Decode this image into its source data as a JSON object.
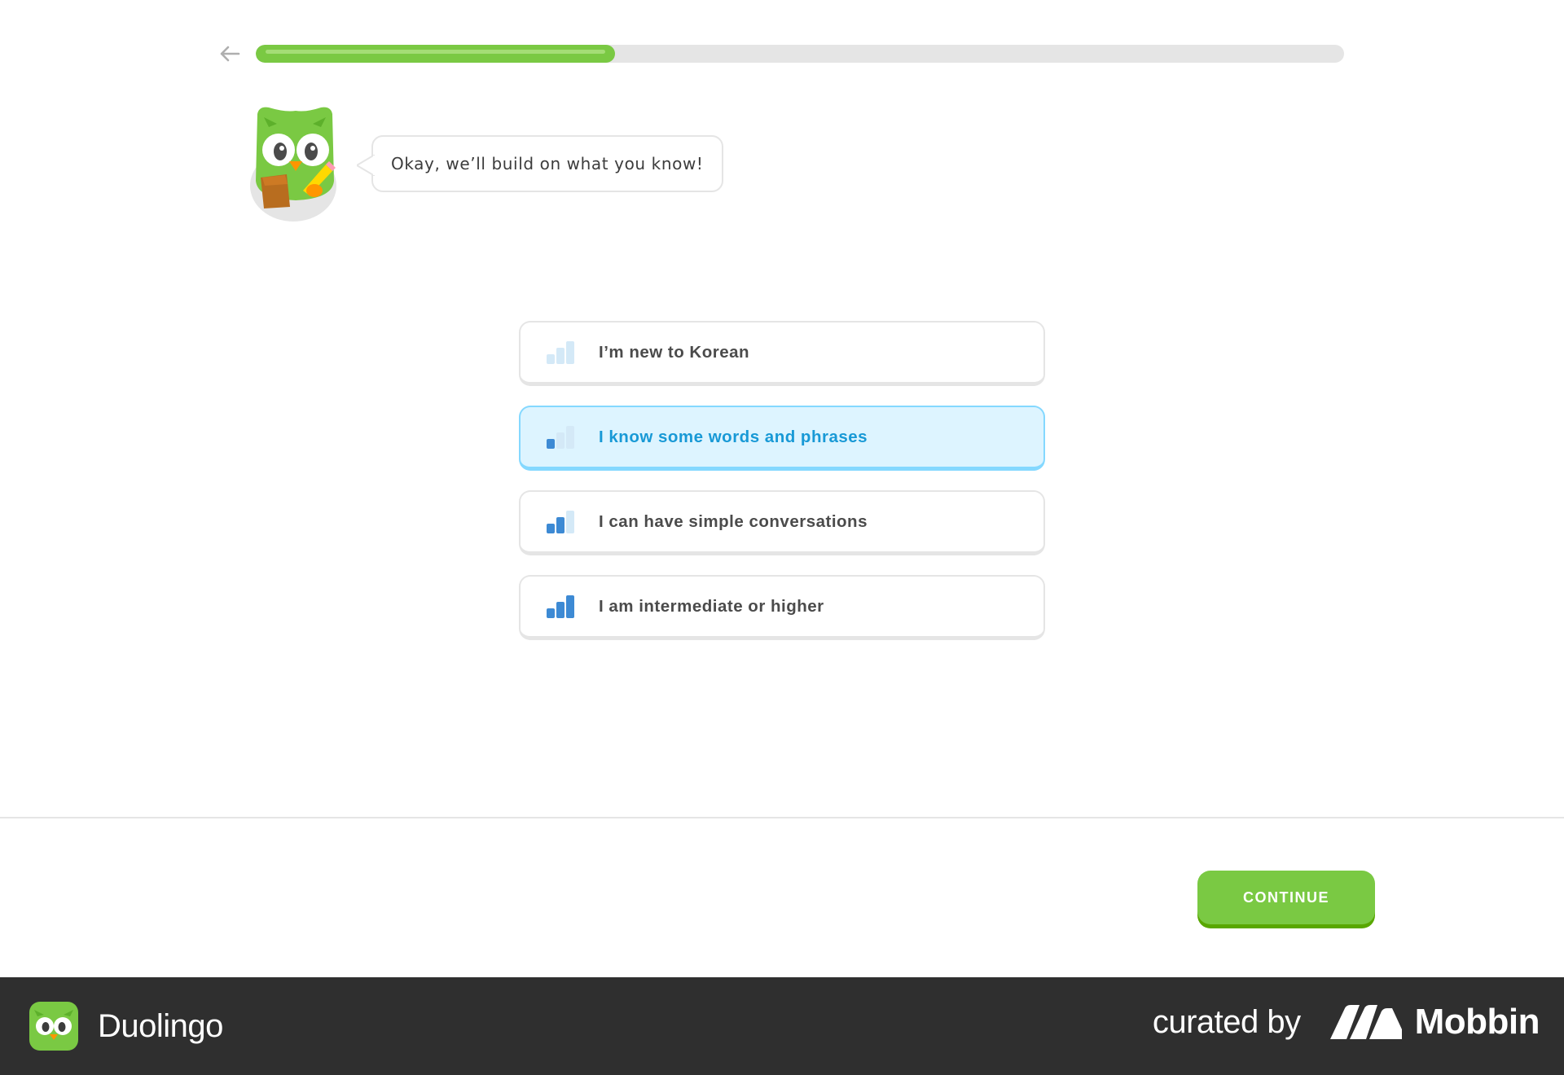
{
  "header": {
    "back_icon": "arrow-left-icon",
    "progress_fraction": 0.33
  },
  "mascot": {
    "icon": "duo-owl-mascot",
    "speech": "Okay, we’ll build on what you know!"
  },
  "options": [
    {
      "label": "I’m new to Korean",
      "level": 0,
      "selected": false,
      "icon": "signal-bars-0-icon"
    },
    {
      "label": "I know some words and phrases",
      "level": 1,
      "selected": true,
      "icon": "signal-bars-1-icon"
    },
    {
      "label": "I can have simple conversations",
      "level": 2,
      "selected": false,
      "icon": "signal-bars-2-icon"
    },
    {
      "label": "I am intermediate or higher",
      "level": 3,
      "selected": false,
      "icon": "signal-bars-3-icon"
    }
  ],
  "footer": {
    "continue_label": "CONTINUE"
  },
  "brand_strip": {
    "app_name": "Duolingo",
    "curated_by": "curated by",
    "curator": "Mobbin"
  },
  "colors": {
    "green": "#7ac943",
    "green_shadow": "#58a700",
    "selected_bg": "#ddf4ff",
    "selected_border": "#84d8ff",
    "selected_text": "#1899d6",
    "bar_active": "#3d8ad4",
    "bar_inactive": "#d4e9f7"
  }
}
